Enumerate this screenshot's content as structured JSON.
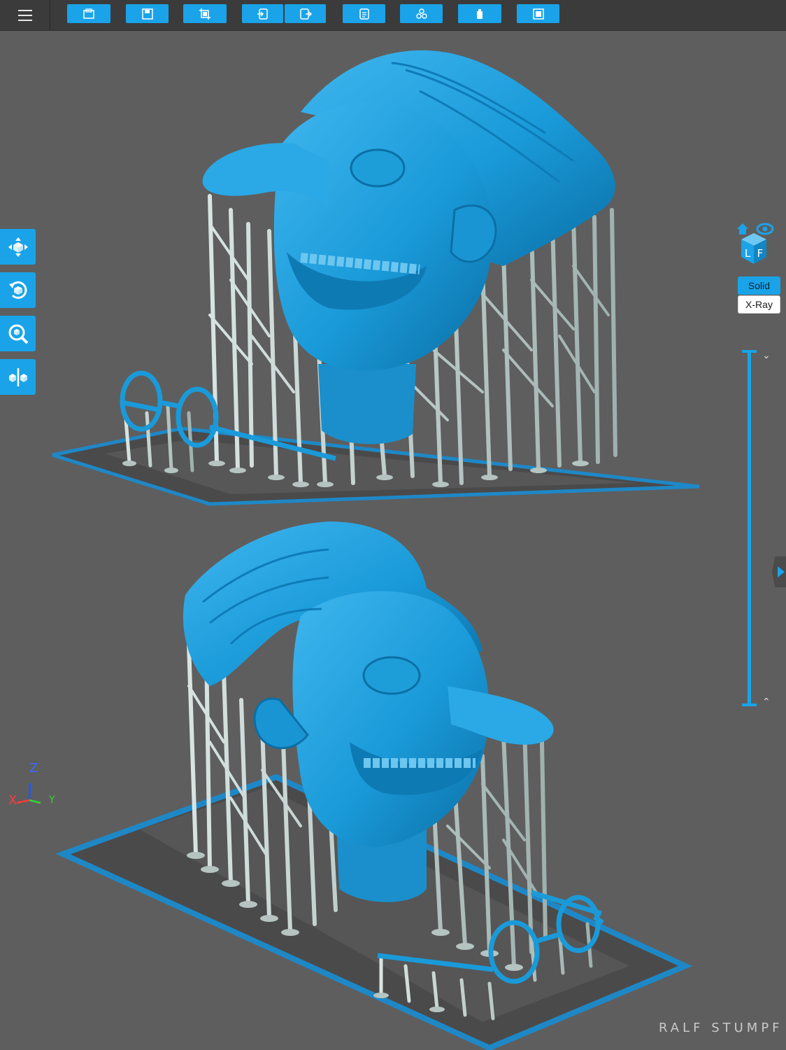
{
  "toolbar": {
    "buttons": [
      {
        "name": "open-file-icon"
      },
      {
        "name": "save-icon"
      },
      {
        "name": "crop-icon"
      },
      {
        "name": "import-icon"
      },
      {
        "name": "export-icon"
      },
      {
        "name": "copy-icon"
      },
      {
        "name": "arrange-icon"
      },
      {
        "name": "resin-bottle-icon"
      },
      {
        "name": "slice-icon"
      }
    ]
  },
  "left_tools": [
    "move-icon",
    "rotate-icon",
    "scale-icon",
    "mirror-icon"
  ],
  "view_modes": {
    "solid": "Solid",
    "xray": "X-Ray",
    "selected": "Solid"
  },
  "viewcube": {
    "left_face": "L",
    "front_face": "F"
  },
  "axes": {
    "z": "Z",
    "x": "X",
    "y": "Y"
  },
  "watermark": "RALF STUMPF",
  "colors": {
    "accent": "#1aa3e8",
    "model": "#1a9ad9",
    "support": "#b9c9c6",
    "background": "#5e5e5e",
    "toolbar": "#3b3b3b"
  }
}
